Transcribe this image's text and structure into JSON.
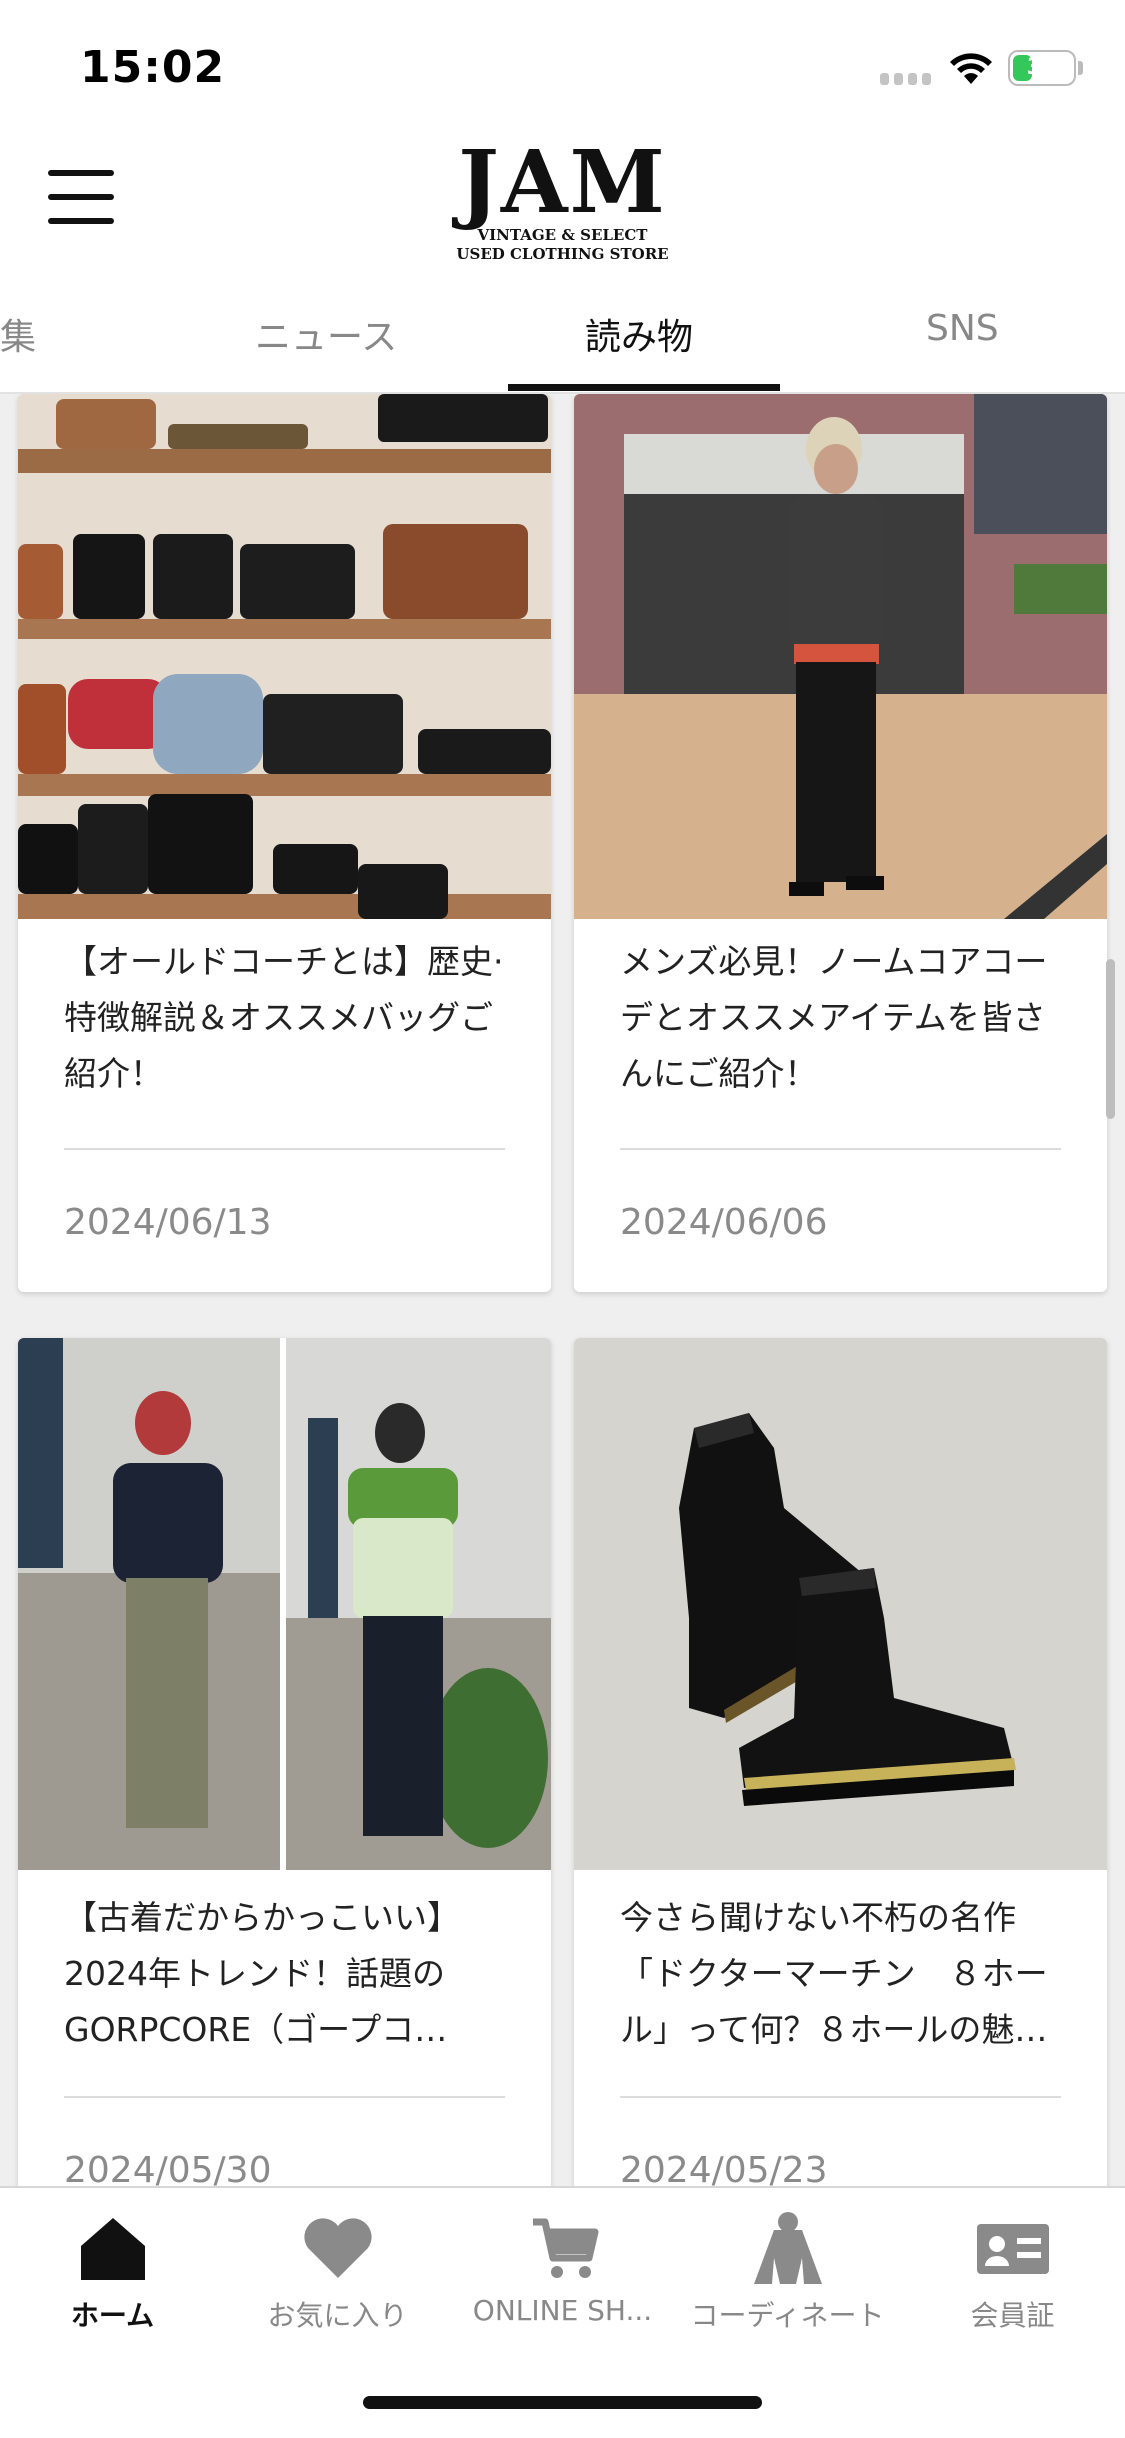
{
  "status_bar": {
    "time": "15:02",
    "battery": "30"
  },
  "header": {
    "logo_main": "JAM",
    "logo_line1": "VINTAGE & SELECT",
    "logo_line2": "USED CLOTHING STORE",
    "menu_icon": "hamburger-menu-icon"
  },
  "tabs": [
    {
      "label": "集",
      "active": false
    },
    {
      "label": "ニュース",
      "active": false
    },
    {
      "label": "読み物",
      "active": true
    },
    {
      "label": "SNS",
      "active": false
    }
  ],
  "articles": [
    {
      "title": "【オールドコーチとは】歴史·特徴解説＆オススメバッグご紹介！",
      "date": "2024/06/13",
      "image": "vintage-coach-bags-on-shelves"
    },
    {
      "title": "メンズ必見！ノームコアコーデとオススメアイテムを皆さんにご紹介！",
      "date": "2024/06/06",
      "image": "man-in-normcore-outfit"
    },
    {
      "title": "【古着だからかっこいい】2024年トレンド！話題のGORPCORE（ゴープコ…",
      "date": "2024/05/30",
      "image": "two-people-in-gorpcore-jackets"
    },
    {
      "title": "今さら聞けない不朽の名作「ドクターマーチン　８ホール」って何？８ホールの魅…",
      "date": "2024/05/23",
      "image": "black-leather-boots"
    }
  ],
  "bottom_nav": [
    {
      "label": "ホーム",
      "icon": "home-icon",
      "active": true
    },
    {
      "label": "お気に入り",
      "icon": "heart-icon",
      "active": false
    },
    {
      "label": "ONLINE SH...",
      "icon": "cart-icon",
      "active": false
    },
    {
      "label": "コーディネート",
      "icon": "jacket-icon",
      "active": false
    },
    {
      "label": "会員証",
      "icon": "member-card-icon",
      "active": false
    }
  ],
  "colors": {
    "accent": "#111111",
    "battery": "#34c759",
    "muted_text": "#888888",
    "background": "#efefef"
  }
}
